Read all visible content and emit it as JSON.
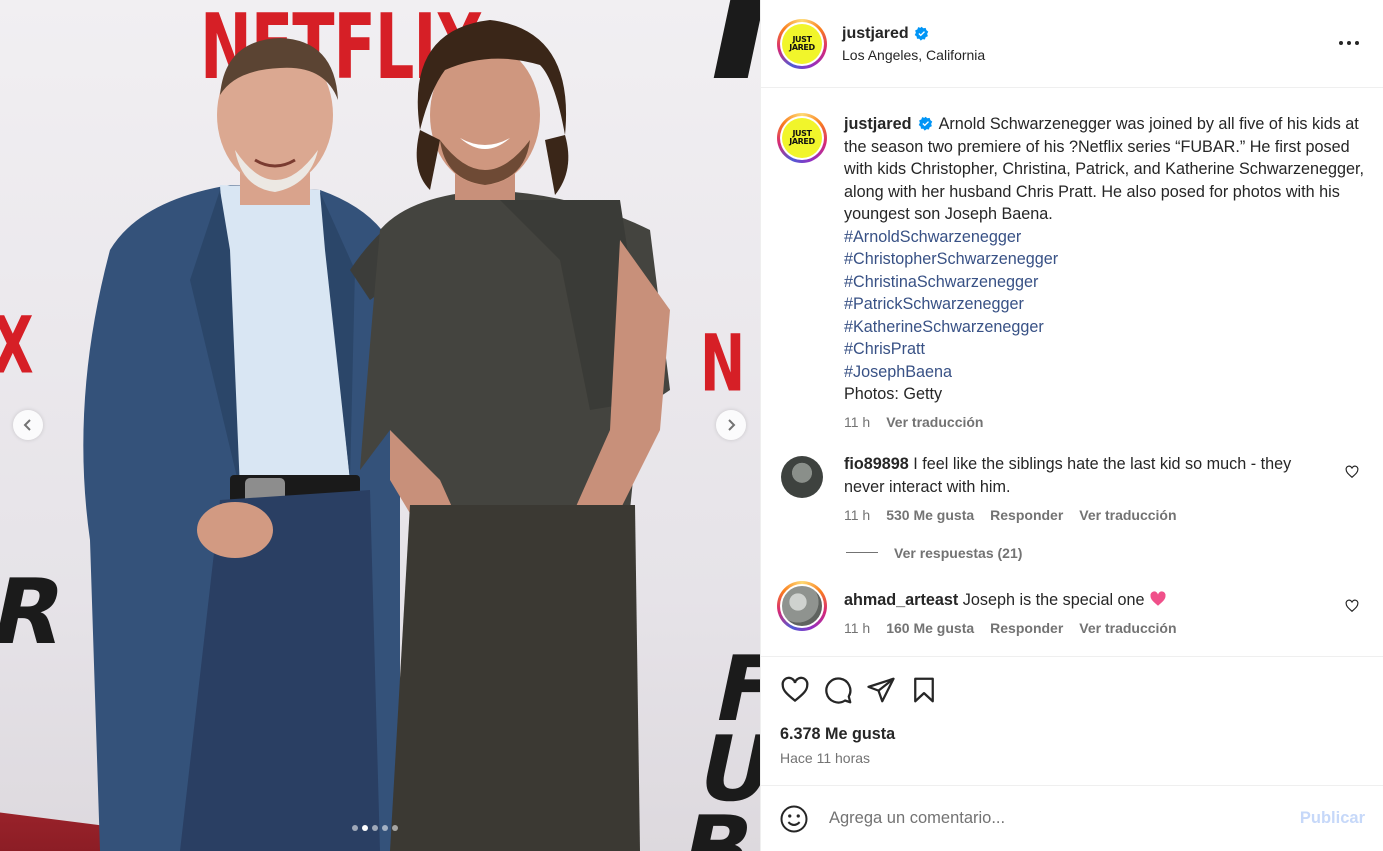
{
  "colors": {
    "accent_link": "#385185",
    "publish_disabled": "#c6d8f9",
    "verified_blue": "#0095f6",
    "heart_red": "#ed4956",
    "logo_yellow": "#f1f52b",
    "netflix_red": "#d61f26"
  },
  "media": {
    "backdrop_texts": {
      "netflix_top": "NETFLIX",
      "netflix_right": "N",
      "netflix_left": "X",
      "netflix_mid": "LI",
      "fubar_left": "R",
      "fubar_right": "FUB"
    },
    "carousel": {
      "total_slides": 5,
      "current_slide": 2
    },
    "icons": {
      "prev": "chevron-left-icon",
      "next": "chevron-right-icon"
    }
  },
  "header": {
    "username": "justjared",
    "location": "Los Angeles, California",
    "avatar_text": [
      "JUST",
      "JARED"
    ],
    "icons": {
      "verified": "verified-badge-icon",
      "more": "more-options-icon"
    }
  },
  "caption": {
    "username": "justjared",
    "text": "Arnold Schwarzenegger was joined by all five of his kids at the season two premiere of his ?Netflix series “FUBAR.” He first posed with kids Christopher, Christina, Patrick, and Katherine Schwarzenegger, along with her husband Chris Pratt. He also posed for photos with his youngest son Joseph Baena.",
    "hashtags": [
      "#ArnoldSchwarzenegger",
      "#ChristopherSchwarzenegger",
      "#ChristinaSchwarzenegger",
      "#PatrickSchwarzenegger",
      "#KatherineSchwarzenegger",
      "#ChrisPratt",
      "#JosephBaena"
    ],
    "photos_credit": "Photos: Getty",
    "time": "11 h",
    "translate": "Ver traducción"
  },
  "comments": [
    {
      "username": "fio89898",
      "text": "I feel like the siblings hate the last kid so much - they never interact with him.",
      "time": "11 h",
      "likes": "530 Me gusta",
      "reply": "Responder",
      "translate": "Ver traducción",
      "view_replies": "Ver respuestas (21)"
    },
    {
      "username": "ahmad_arteast",
      "text": "Joseph is the special one",
      "time": "11 h",
      "likes": "160 Me gusta",
      "reply": "Responder",
      "translate": "Ver traducción"
    }
  ],
  "actions": {
    "icons": [
      "heart-icon",
      "comment-icon",
      "share-icon",
      "bookmark-icon"
    ],
    "likes": "6.378 Me gusta",
    "timestamp": "Hace 11 horas"
  },
  "add_comment": {
    "placeholder": "Agrega un comentario...",
    "publish": "Publicar",
    "emoji_icon": "emoji-icon"
  }
}
